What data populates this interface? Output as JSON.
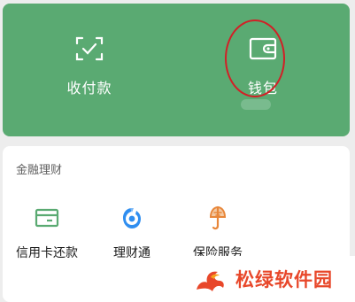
{
  "top_actions": {
    "pay_label": "收付款",
    "pay_icon": "scan-check-icon",
    "wallet_label": "钱包",
    "wallet_icon": "wallet-icon"
  },
  "finance": {
    "title": "金融理财",
    "items": [
      {
        "label": "信用卡还款",
        "icon": "credit-card-repay-icon"
      },
      {
        "label": "理财通",
        "icon": "wealth-management-icon"
      },
      {
        "label": "保险服务",
        "icon": "insurance-icon"
      }
    ]
  },
  "watermark": {
    "text": "松绿软件园",
    "icon": "flame-logo-icon"
  },
  "colors": {
    "brand_green": "#5aaa72",
    "annotation_red": "#d21f26",
    "watermark_orange": "#e8472a",
    "icon_blue": "#2f8ef0",
    "icon_orange": "#e8873a"
  }
}
